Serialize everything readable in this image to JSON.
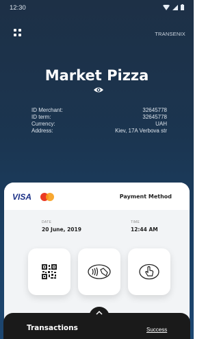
{
  "status_bar": {
    "time": "12:30"
  },
  "header": {
    "brand": "TRANSENIX",
    "menu_icon": "grid-icon",
    "visibility_icon": "eye-icon"
  },
  "merchant": {
    "name": "Market Pizza",
    "fields": [
      {
        "label": "ID Merchant:",
        "value": "32645778"
      },
      {
        "label": "ID term:",
        "value": "32645778"
      },
      {
        "label": "Currency:",
        "value": "UAH"
      },
      {
        "label": "Address:",
        "value": "Kiev, 17A Verbova str"
      }
    ]
  },
  "payment": {
    "card_brand": "VISA",
    "method_label": "Payment Method",
    "date_label": "DATE",
    "date_value": "20 June, 2019",
    "time_label": "TIME",
    "time_value": "12:44 AM",
    "options": [
      "qr-code-icon",
      "contactless-icon",
      "touch-icon"
    ]
  },
  "bottom_bar": {
    "title": "Transactions",
    "link": "Success"
  },
  "colors": {
    "background": "#1b3a5a",
    "card": "#f2f4f6",
    "bottom_bar": "#1a1a1a",
    "visa_blue": "#1a2f86"
  }
}
